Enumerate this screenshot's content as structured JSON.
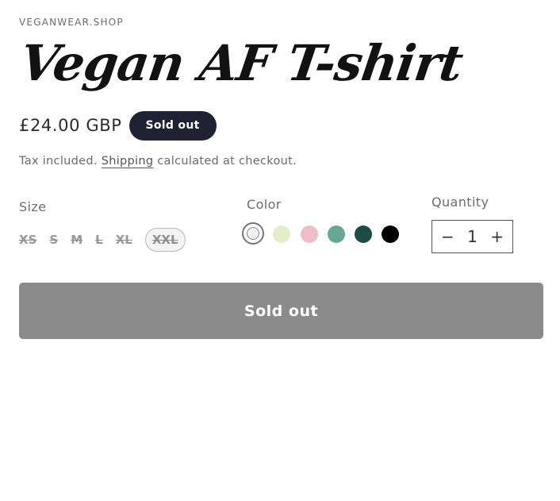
{
  "product": {
    "vendor": "VEGANWEAR.SHOP",
    "title": "Vegan AF T-shirt",
    "price": "£24.00 GBP",
    "badge": "Sold out",
    "tax_prefix": "Tax included. ",
    "tax_link": "Shipping",
    "tax_suffix": " calculated at checkout."
  },
  "size": {
    "label": "Size",
    "options": [
      "XS",
      "S",
      "M",
      "L",
      "XL",
      "XXL"
    ],
    "selected": "XXL",
    "all_unavailable": true
  },
  "color": {
    "label": "Color",
    "options": [
      {
        "name": "white",
        "hex": "#f1f1f1",
        "selected": true
      },
      {
        "name": "cream",
        "hex": "#e4ecc9",
        "selected": false
      },
      {
        "name": "pink",
        "hex": "#efbfc8",
        "selected": false
      },
      {
        "name": "sage",
        "hex": "#65a895",
        "selected": false
      },
      {
        "name": "dark-green",
        "hex": "#1d4d46",
        "selected": false
      },
      {
        "name": "black",
        "hex": "#000000",
        "selected": false
      }
    ]
  },
  "quantity": {
    "label": "Quantity",
    "decrease": "−",
    "value": "1",
    "increase": "+"
  },
  "buy_button": {
    "label": "Sold out",
    "disabled": true
  }
}
